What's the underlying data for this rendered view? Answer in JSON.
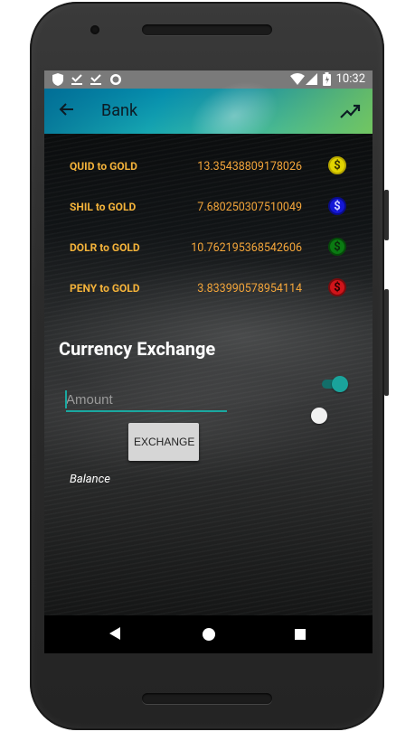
{
  "statusbar": {
    "time": "10:32",
    "left_icons": [
      "shield-icon",
      "download-check-icon",
      "download-check-icon",
      "circle-icon"
    ],
    "right_icons": [
      "wifi-icon",
      "signal-icon",
      "battery-icon"
    ]
  },
  "appbar": {
    "title": "Bank",
    "back_icon": "arrow-left-icon",
    "action_icon": "trending-up-icon"
  },
  "rates": [
    {
      "label": "QUID to GOLD",
      "value": "13.35438809178026",
      "coin_color": "#e2d400"
    },
    {
      "label": "SHIL to GOLD",
      "value": "7.680250307510049",
      "coin_color": "#1417d6"
    },
    {
      "label": "DOLR to GOLD",
      "value": "10.762195368542606",
      "coin_color": "#0a7a12"
    },
    {
      "label": "PENY to GOLD",
      "value": "3.833990578954114",
      "coin_color": "#d0141a"
    }
  ],
  "coin_symbol": "$",
  "exchange": {
    "title": "Currency Exchange",
    "amount_placeholder": "Amount",
    "button_label": "EXCHANGE",
    "balance_label": "Balance",
    "switch1_on": true,
    "switch2_on": false
  },
  "colors": {
    "accent": "#1aa8a0",
    "rate_text": "#f3b23a"
  }
}
